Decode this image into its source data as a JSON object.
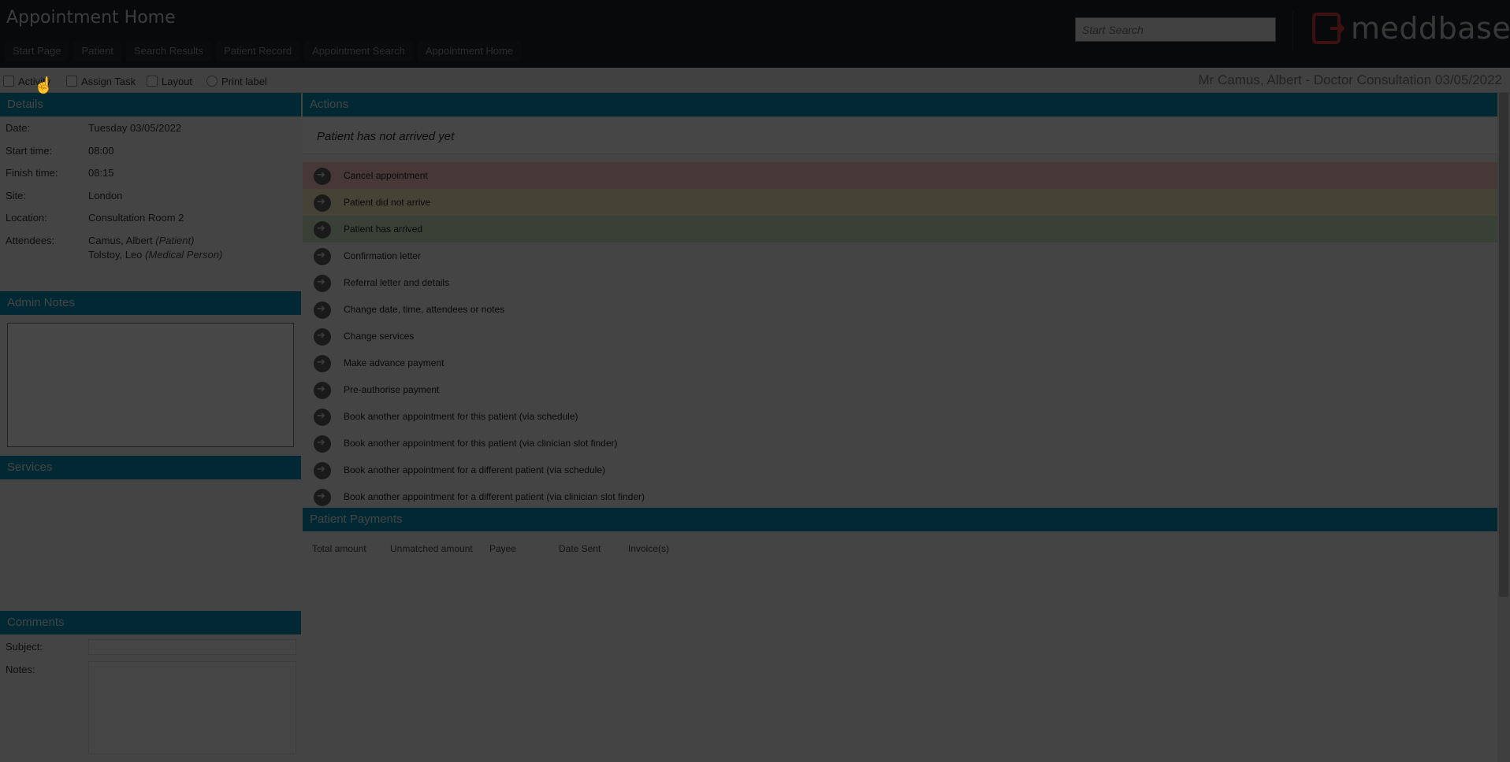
{
  "app_title": "Appointment Home",
  "nav": [
    "Start Page",
    "Patient",
    "Search Results",
    "Patient Record",
    "Appointment Search",
    "Appointment Home"
  ],
  "search": {
    "placeholder": "Start Search"
  },
  "brand": {
    "name": "meddbase",
    "color": "#e23b3b"
  },
  "toolbar": {
    "activity": "Activity",
    "assign_task": "Assign Task",
    "layout": "Layout",
    "print_label": "Print label"
  },
  "appointment_header": "Mr Camus, Albert - Doctor Consultation 03/05/2022",
  "details": {
    "title": "Details",
    "rows": [
      {
        "label": "Date:",
        "value": "Tuesday 03/05/2022"
      },
      {
        "label": "Start time:",
        "value": "08:00"
      },
      {
        "label": "Finish time:",
        "value": "08:15"
      },
      {
        "label": "Site:",
        "value": "London"
      },
      {
        "label": "Location:",
        "value": "Consultation Room 2"
      }
    ],
    "attendees_label": "Attendees:",
    "attendees": [
      {
        "name": "Camus, Albert",
        "role": "(Patient)"
      },
      {
        "name": "Tolstoy, Leo",
        "role": "(Medical Person)"
      }
    ]
  },
  "admin_notes": {
    "title": "Admin Notes"
  },
  "services": {
    "title": "Services"
  },
  "comments": {
    "title": "Comments",
    "subject_label": "Subject:",
    "notes_label": "Notes:"
  },
  "actions": {
    "title": "Actions",
    "status": "Patient has not arrived yet",
    "items": [
      {
        "label": "Cancel appointment",
        "tone": "red"
      },
      {
        "label": "Patient did not arrive",
        "tone": "yellow"
      },
      {
        "label": "Patient has arrived",
        "tone": "green"
      },
      {
        "label": "Confirmation letter",
        "tone": "none"
      },
      {
        "label": "Referral letter and details",
        "tone": "none"
      },
      {
        "label": "Change date, time, attendees or notes",
        "tone": "none"
      },
      {
        "label": "Change services",
        "tone": "none"
      },
      {
        "label": "Make advance payment",
        "tone": "none"
      },
      {
        "label": "Pre-authorise payment",
        "tone": "none"
      },
      {
        "label": "Book another appointment for this patient (via schedule)",
        "tone": "none"
      },
      {
        "label": "Book another appointment for this patient (via clinician slot finder)",
        "tone": "none"
      },
      {
        "label": "Book another appointment for a different patient (via schedule)",
        "tone": "none"
      },
      {
        "label": "Book another appointment for a different patient (via clinician slot finder)",
        "tone": "none"
      }
    ]
  },
  "payments": {
    "title": "Patient Payments",
    "columns": [
      "Total amount",
      "Unmatched amount",
      "Payee",
      "Date Sent",
      "Invoice(s)"
    ]
  }
}
